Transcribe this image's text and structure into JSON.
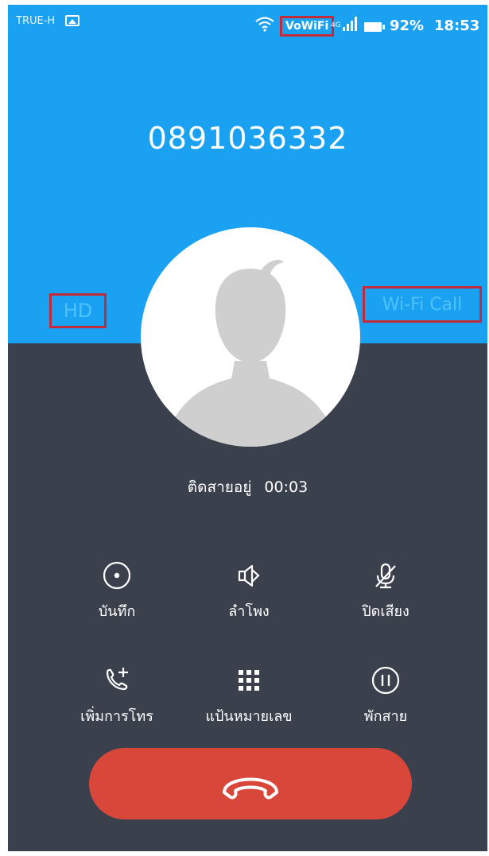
{
  "status_bar": {
    "carrier": "TRUE-H",
    "vowifi": "VoWiFi",
    "network": "4G",
    "battery": "92%",
    "time": "18:53"
  },
  "call": {
    "number": "0891036332",
    "hd_label": "HD",
    "wifi_call_label": "Wi-Fi Call",
    "state": "ติดสายอยู่",
    "duration": "00:03"
  },
  "controls": [
    {
      "label": "บันทึก",
      "icon": "record-icon"
    },
    {
      "label": "ลำโพง",
      "icon": "speaker-icon"
    },
    {
      "label": "ปิดเสียง",
      "icon": "mute-icon"
    },
    {
      "label": "เพิ่มการโทร",
      "icon": "add-call-icon"
    },
    {
      "label": "แป้นหมายเลข",
      "icon": "dialpad-icon"
    },
    {
      "label": "พักสาย",
      "icon": "hold-icon"
    }
  ],
  "colors": {
    "header": "#1ba1f2",
    "background": "#3a404c",
    "end_call": "#d9473b",
    "highlight_box": "#c12b3b"
  }
}
